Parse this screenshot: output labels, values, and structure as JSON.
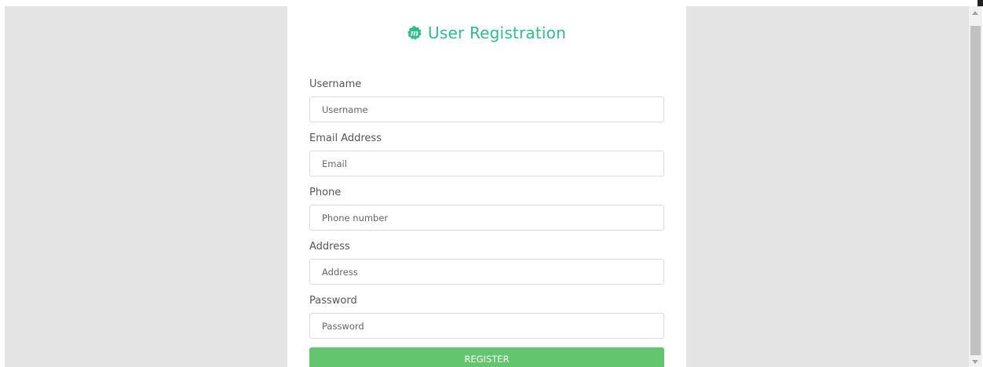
{
  "page": {
    "title": "User Registration",
    "logo_icon": "m-badge-icon",
    "accent_color": "#2bbf8a",
    "button_color": "#63c56d",
    "background_color": "#e4e4e4"
  },
  "form": {
    "fields": [
      {
        "label": "Username",
        "placeholder": "Username",
        "value": ""
      },
      {
        "label": "Email Address",
        "placeholder": "Email",
        "value": ""
      },
      {
        "label": "Phone",
        "placeholder": "Phone number",
        "value": ""
      },
      {
        "label": "Address",
        "placeholder": "Address",
        "value": ""
      },
      {
        "label": "Password",
        "placeholder": "Password",
        "value": ""
      }
    ],
    "submit_label": "REGISTER"
  }
}
